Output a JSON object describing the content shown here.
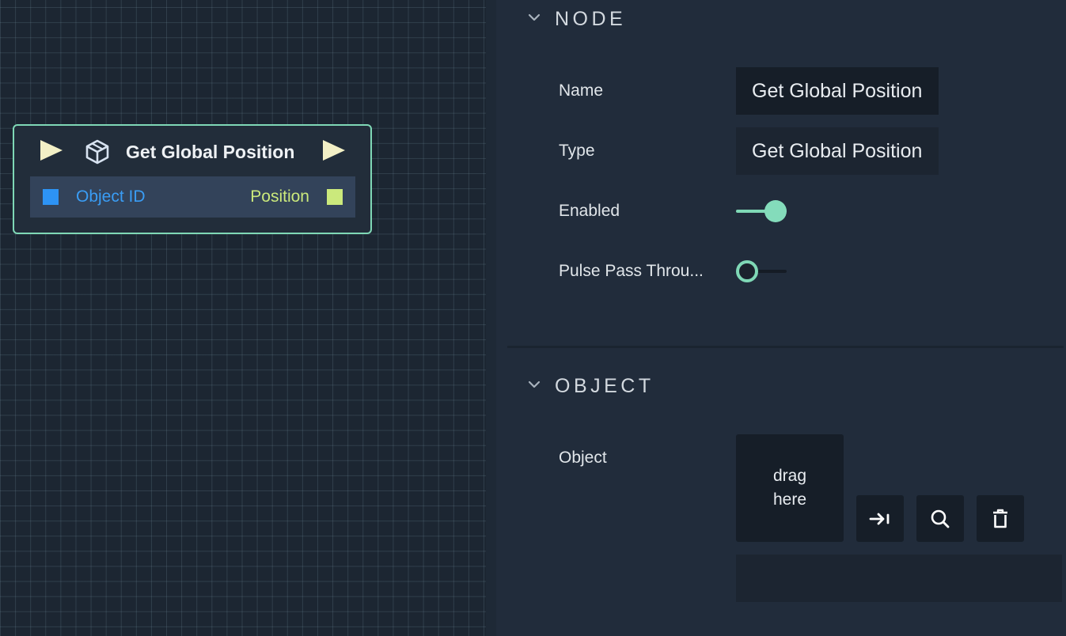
{
  "node": {
    "title": "Get Global Position",
    "ports": {
      "input_label": "Object ID",
      "output_label": "Position"
    }
  },
  "inspector": {
    "sections": {
      "node": {
        "title": "NODE",
        "properties": {
          "name": {
            "label": "Name",
            "value": "Get Global Position"
          },
          "type": {
            "label": "Type",
            "value": "Get Global Position"
          },
          "enabled": {
            "label": "Enabled",
            "on": true
          },
          "pulse_pass_through": {
            "label": "Pulse Pass Throu...",
            "on": false
          }
        }
      },
      "object": {
        "title": "OBJECT",
        "properties": {
          "object": {
            "label": "Object",
            "drop_hint": "drag\nhere",
            "value": ""
          }
        },
        "buttons": {
          "assign_icon": "arrow-to-line-icon",
          "find_icon": "search-icon",
          "delete_icon": "trash-icon"
        }
      }
    }
  },
  "colors": {
    "accent": "#7fd8b6",
    "input_port": "#2d93f5",
    "output_port": "#cbe97c",
    "flow_arrow": "#f3f0c6"
  }
}
